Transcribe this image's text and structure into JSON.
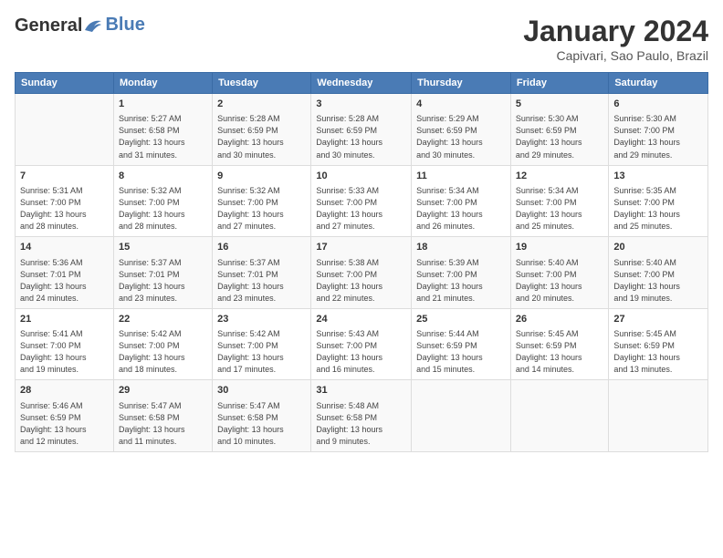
{
  "header": {
    "logo_line1": "General",
    "logo_line2": "Blue",
    "month": "January 2024",
    "location": "Capivari, Sao Paulo, Brazil"
  },
  "days_of_week": [
    "Sunday",
    "Monday",
    "Tuesday",
    "Wednesday",
    "Thursday",
    "Friday",
    "Saturday"
  ],
  "weeks": [
    [
      {
        "day": "",
        "info": ""
      },
      {
        "day": "1",
        "info": "Sunrise: 5:27 AM\nSunset: 6:58 PM\nDaylight: 13 hours\nand 31 minutes."
      },
      {
        "day": "2",
        "info": "Sunrise: 5:28 AM\nSunset: 6:59 PM\nDaylight: 13 hours\nand 30 minutes."
      },
      {
        "day": "3",
        "info": "Sunrise: 5:28 AM\nSunset: 6:59 PM\nDaylight: 13 hours\nand 30 minutes."
      },
      {
        "day": "4",
        "info": "Sunrise: 5:29 AM\nSunset: 6:59 PM\nDaylight: 13 hours\nand 30 minutes."
      },
      {
        "day": "5",
        "info": "Sunrise: 5:30 AM\nSunset: 6:59 PM\nDaylight: 13 hours\nand 29 minutes."
      },
      {
        "day": "6",
        "info": "Sunrise: 5:30 AM\nSunset: 7:00 PM\nDaylight: 13 hours\nand 29 minutes."
      }
    ],
    [
      {
        "day": "7",
        "info": "Sunrise: 5:31 AM\nSunset: 7:00 PM\nDaylight: 13 hours\nand 28 minutes."
      },
      {
        "day": "8",
        "info": "Sunrise: 5:32 AM\nSunset: 7:00 PM\nDaylight: 13 hours\nand 28 minutes."
      },
      {
        "day": "9",
        "info": "Sunrise: 5:32 AM\nSunset: 7:00 PM\nDaylight: 13 hours\nand 27 minutes."
      },
      {
        "day": "10",
        "info": "Sunrise: 5:33 AM\nSunset: 7:00 PM\nDaylight: 13 hours\nand 27 minutes."
      },
      {
        "day": "11",
        "info": "Sunrise: 5:34 AM\nSunset: 7:00 PM\nDaylight: 13 hours\nand 26 minutes."
      },
      {
        "day": "12",
        "info": "Sunrise: 5:34 AM\nSunset: 7:00 PM\nDaylight: 13 hours\nand 25 minutes."
      },
      {
        "day": "13",
        "info": "Sunrise: 5:35 AM\nSunset: 7:00 PM\nDaylight: 13 hours\nand 25 minutes."
      }
    ],
    [
      {
        "day": "14",
        "info": "Sunrise: 5:36 AM\nSunset: 7:01 PM\nDaylight: 13 hours\nand 24 minutes."
      },
      {
        "day": "15",
        "info": "Sunrise: 5:37 AM\nSunset: 7:01 PM\nDaylight: 13 hours\nand 23 minutes."
      },
      {
        "day": "16",
        "info": "Sunrise: 5:37 AM\nSunset: 7:01 PM\nDaylight: 13 hours\nand 23 minutes."
      },
      {
        "day": "17",
        "info": "Sunrise: 5:38 AM\nSunset: 7:00 PM\nDaylight: 13 hours\nand 22 minutes."
      },
      {
        "day": "18",
        "info": "Sunrise: 5:39 AM\nSunset: 7:00 PM\nDaylight: 13 hours\nand 21 minutes."
      },
      {
        "day": "19",
        "info": "Sunrise: 5:40 AM\nSunset: 7:00 PM\nDaylight: 13 hours\nand 20 minutes."
      },
      {
        "day": "20",
        "info": "Sunrise: 5:40 AM\nSunset: 7:00 PM\nDaylight: 13 hours\nand 19 minutes."
      }
    ],
    [
      {
        "day": "21",
        "info": "Sunrise: 5:41 AM\nSunset: 7:00 PM\nDaylight: 13 hours\nand 19 minutes."
      },
      {
        "day": "22",
        "info": "Sunrise: 5:42 AM\nSunset: 7:00 PM\nDaylight: 13 hours\nand 18 minutes."
      },
      {
        "day": "23",
        "info": "Sunrise: 5:42 AM\nSunset: 7:00 PM\nDaylight: 13 hours\nand 17 minutes."
      },
      {
        "day": "24",
        "info": "Sunrise: 5:43 AM\nSunset: 7:00 PM\nDaylight: 13 hours\nand 16 minutes."
      },
      {
        "day": "25",
        "info": "Sunrise: 5:44 AM\nSunset: 6:59 PM\nDaylight: 13 hours\nand 15 minutes."
      },
      {
        "day": "26",
        "info": "Sunrise: 5:45 AM\nSunset: 6:59 PM\nDaylight: 13 hours\nand 14 minutes."
      },
      {
        "day": "27",
        "info": "Sunrise: 5:45 AM\nSunset: 6:59 PM\nDaylight: 13 hours\nand 13 minutes."
      }
    ],
    [
      {
        "day": "28",
        "info": "Sunrise: 5:46 AM\nSunset: 6:59 PM\nDaylight: 13 hours\nand 12 minutes."
      },
      {
        "day": "29",
        "info": "Sunrise: 5:47 AM\nSunset: 6:58 PM\nDaylight: 13 hours\nand 11 minutes."
      },
      {
        "day": "30",
        "info": "Sunrise: 5:47 AM\nSunset: 6:58 PM\nDaylight: 13 hours\nand 10 minutes."
      },
      {
        "day": "31",
        "info": "Sunrise: 5:48 AM\nSunset: 6:58 PM\nDaylight: 13 hours\nand 9 minutes."
      },
      {
        "day": "",
        "info": ""
      },
      {
        "day": "",
        "info": ""
      },
      {
        "day": "",
        "info": ""
      }
    ]
  ]
}
